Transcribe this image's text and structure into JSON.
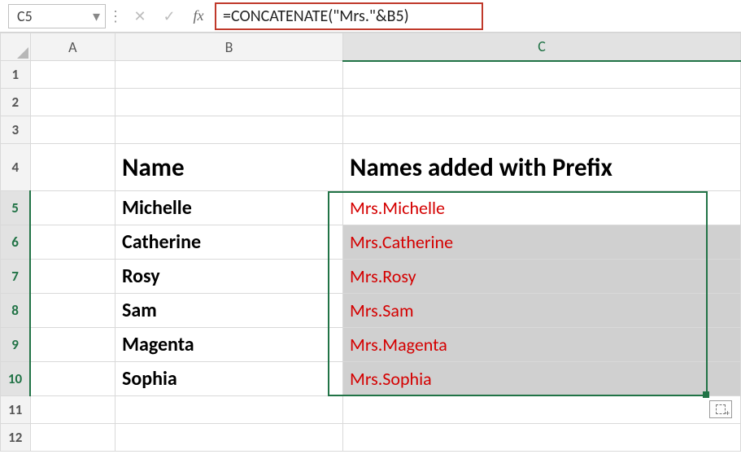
{
  "formula_bar": {
    "name_box": "C5",
    "cancel_icon": "✕",
    "enter_icon": "✓",
    "fx_label": "fx",
    "formula": "=CONCATENATE(\"Mrs.\"&B5)"
  },
  "columns": {
    "A": "A",
    "B": "B",
    "C": "C"
  },
  "row_numbers": [
    "1",
    "2",
    "3",
    "4",
    "5",
    "6",
    "7",
    "8",
    "9",
    "10",
    "11",
    "12"
  ],
  "headers": {
    "B": "Name",
    "C": "Names added with Prefix"
  },
  "rows": [
    {
      "b": "Michelle",
      "c": "Mrs.Michelle"
    },
    {
      "b": "Catherine",
      "c": "Mrs.Catherine"
    },
    {
      "b": "Rosy",
      "c": "Mrs.Rosy"
    },
    {
      "b": "Sam",
      "c": "Mrs.Sam"
    },
    {
      "b": "Magenta",
      "c": "Mrs.Magenta"
    },
    {
      "b": "Sophia",
      "c": "Mrs.Sophia"
    }
  ],
  "icons": {
    "dropdown": "▾",
    "dots": "⋮"
  }
}
